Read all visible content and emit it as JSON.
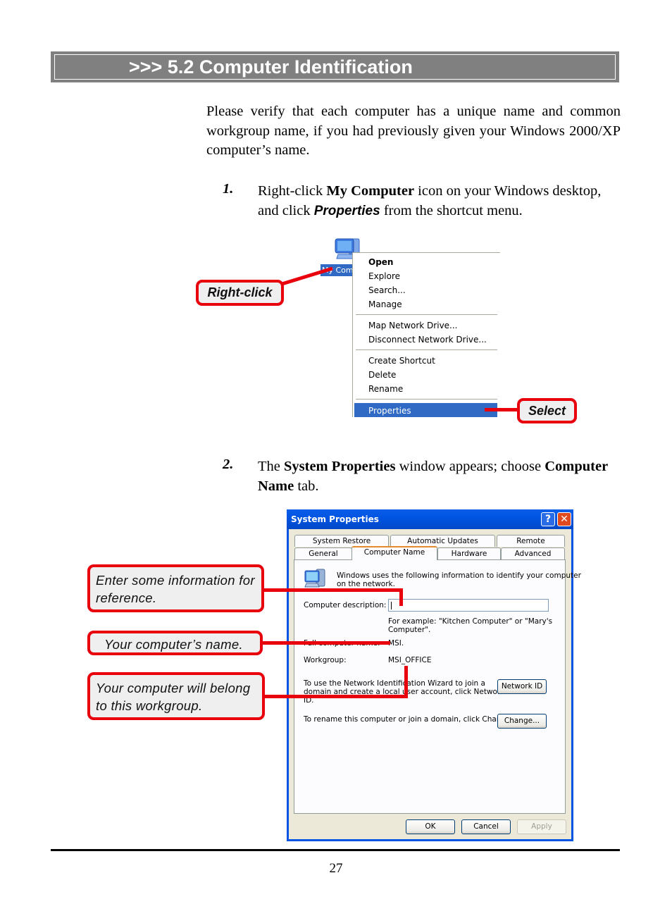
{
  "header": {
    "title": ">>> 5.2  Computer Identification"
  },
  "intro": "Please verify that each computer has a unique name and common workgroup name, if you had previously given your Windows 2000/XP computer’s name.",
  "steps": [
    {
      "number": "1.",
      "parts": [
        "Right-click ",
        "My Computer",
        " icon on your Windows desktop, and click ",
        "Properties",
        " from the shortcut menu."
      ]
    },
    {
      "number": "2.",
      "parts": [
        "The ",
        "System Properties",
        " window appears; choose ",
        "Computer Name",
        " tab."
      ]
    }
  ],
  "desktop_icon": {
    "label": "My Computer",
    "icon": "my-computer-icon"
  },
  "context_menu": {
    "groups": [
      [
        "Open",
        "Explore",
        "Search...",
        "Manage"
      ],
      [
        "Map Network Drive...",
        "Disconnect Network Drive..."
      ],
      [
        "Create Shortcut",
        "Delete",
        "Rename"
      ],
      [
        "Properties"
      ]
    ],
    "default_item": "Open",
    "selected_item": "Properties"
  },
  "callouts": {
    "right_click": "Right-click",
    "select": "Select",
    "description": "Enter some information for reference.",
    "name": "Your computer’s name.",
    "workgroup": "Your computer will belong to this workgroup."
  },
  "dialog": {
    "title": "System Properties",
    "help_label": "?",
    "close_label": "✕",
    "tabs_back": [
      "System Restore",
      "Automatic Updates",
      "Remote"
    ],
    "tabs_front": [
      "General",
      "Computer Name",
      "Hardware",
      "Advanced"
    ],
    "active_tab": "Computer Name",
    "info_line1": "Windows uses the following information to identify your computer",
    "info_line2": "on the network.",
    "description_label": "Computer description:",
    "description_value": "",
    "example_line1": "For example: \"Kitchen Computer\" or \"Mary's",
    "example_line2": "Computer\".",
    "full_name_label": "Full computer name:",
    "full_name_value": "MSI.",
    "workgroup_label": "Workgroup:",
    "workgroup_value": "MSI_OFFICE",
    "network_id_text": [
      "To use the Network Identification Wizard to join a",
      "domain and create a local user account, click Network",
      "ID."
    ],
    "network_id_button": "Network ID",
    "change_text": "To rename this computer or join a domain, click Change.",
    "change_button": "Change...",
    "ok_button": "OK",
    "cancel_button": "Cancel",
    "apply_button": "Apply"
  },
  "colors": {
    "callout_red": "#e8000d",
    "xp_blue": "#0054e3",
    "selection_blue": "#316ac5",
    "banner_gray": "#808080"
  },
  "footer": {
    "page_number": "27"
  }
}
